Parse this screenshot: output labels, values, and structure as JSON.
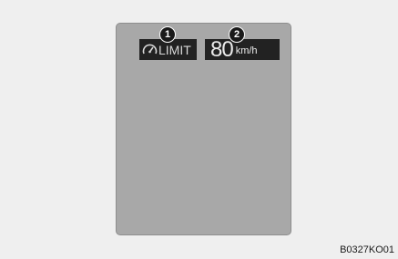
{
  "display": {
    "limit_label": "LIMIT",
    "limit_icon": "speedometer-icon",
    "speed_value": "80",
    "speed_unit": "km/h"
  },
  "callouts": {
    "one": "1",
    "two": "2"
  },
  "figure_code": "B0327KO01",
  "colors": {
    "panel": "#a8a8a8",
    "badge": "#222222",
    "background": "#efefef"
  }
}
